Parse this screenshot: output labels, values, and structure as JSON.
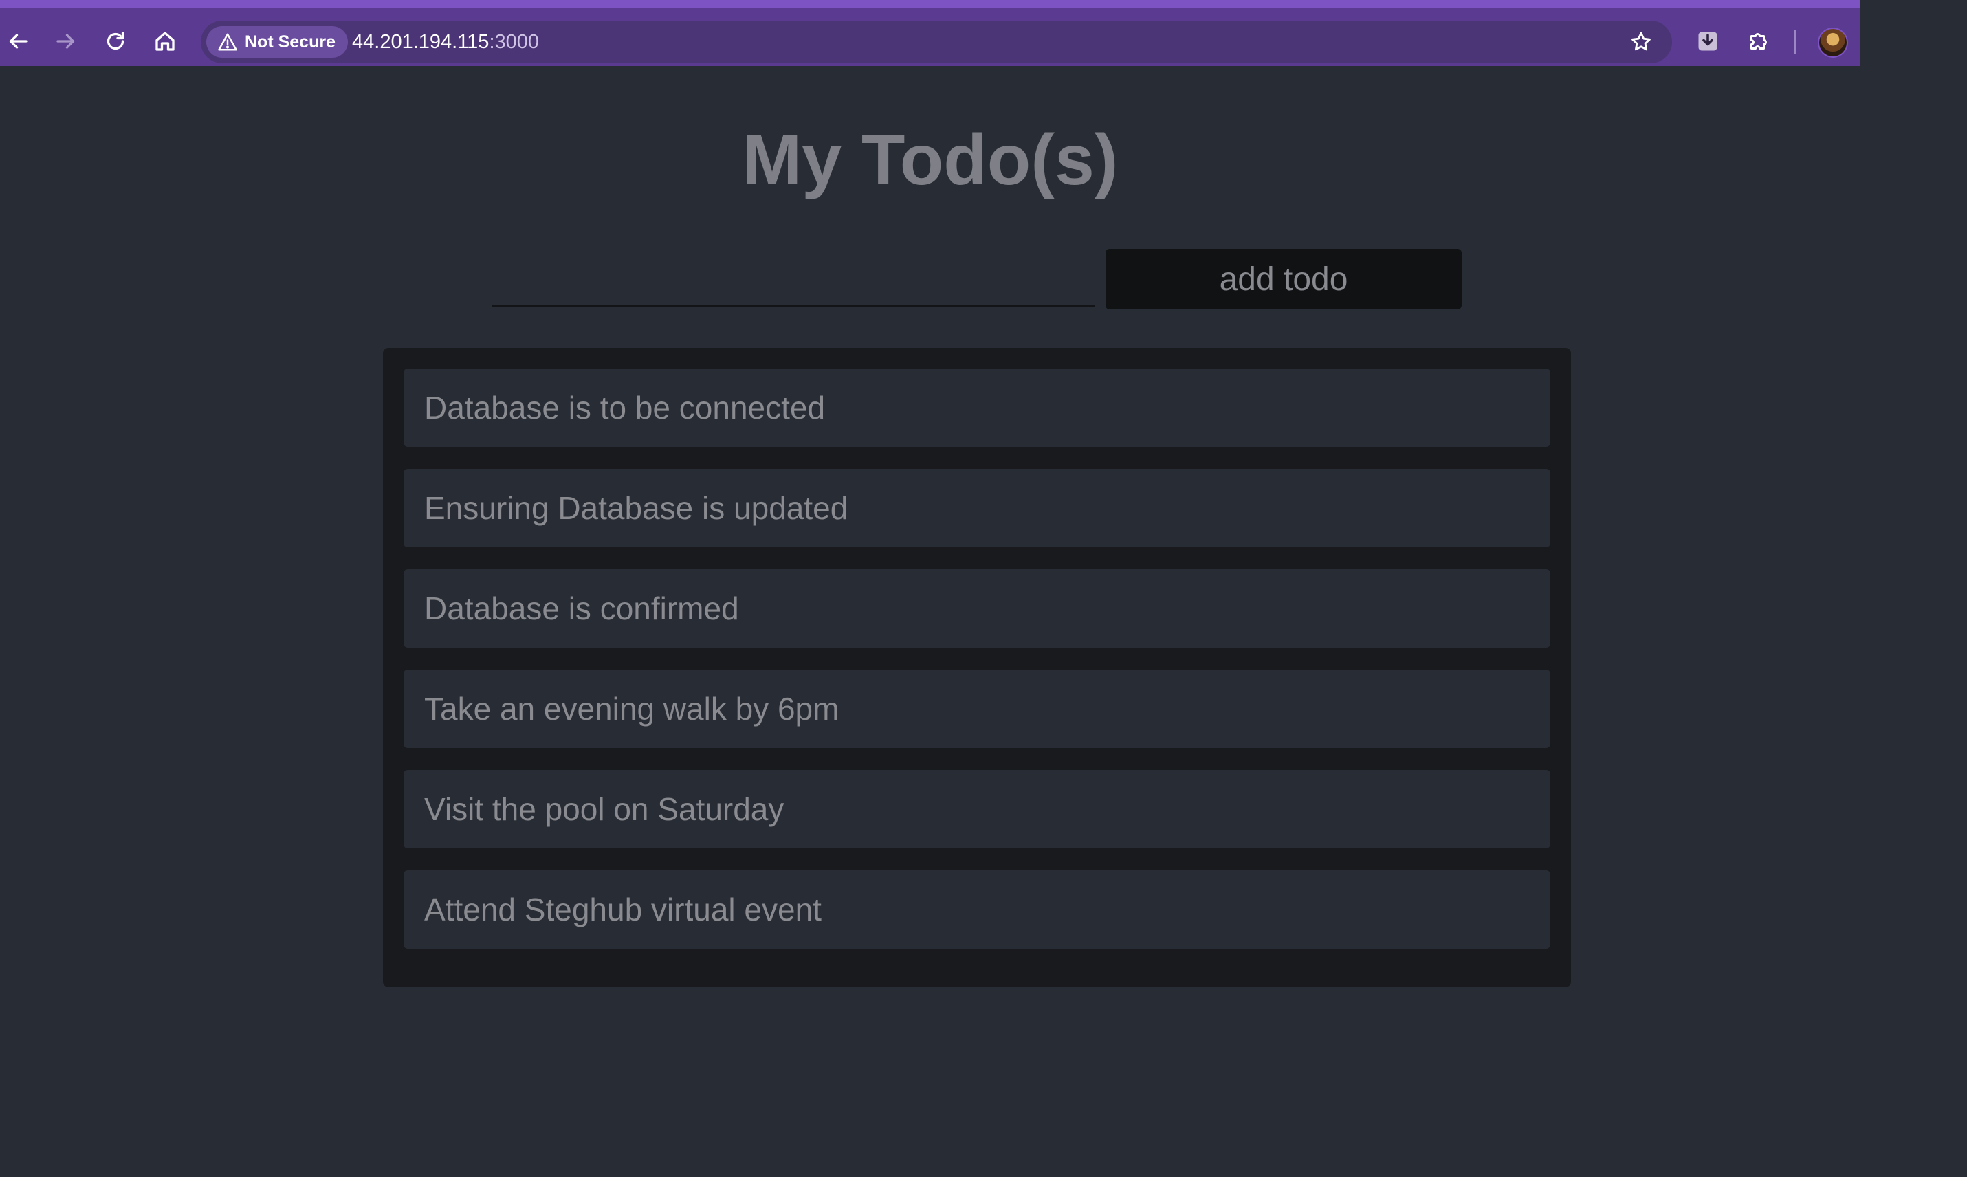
{
  "browser": {
    "security_label": "Not Secure",
    "url_host": "44.201.194.115",
    "url_port": ":3000",
    "icons": {
      "back": "arrow-left-icon",
      "forward": "arrow-right-icon",
      "reload": "reload-icon",
      "home": "home-icon",
      "warning": "warning-triangle-icon",
      "bookmark": "star-icon",
      "download": "download-icon",
      "extensions": "puzzle-icon"
    },
    "colors": {
      "frame": "#5b3a91",
      "omnibox": "#4c3576"
    }
  },
  "page": {
    "title": "My Todo(s)",
    "input_value": "",
    "add_button_label": "add todo",
    "todos": [
      "Database is to be connected",
      "Ensuring Database is updated",
      "Database is confirmed",
      "Take an evening walk by 6pm",
      "Visit the pool on Saturday",
      "Attend Steghub virtual event"
    ],
    "colors": {
      "background": "#282c34",
      "list_background": "#191a1e",
      "text": "#8a8b91"
    }
  }
}
